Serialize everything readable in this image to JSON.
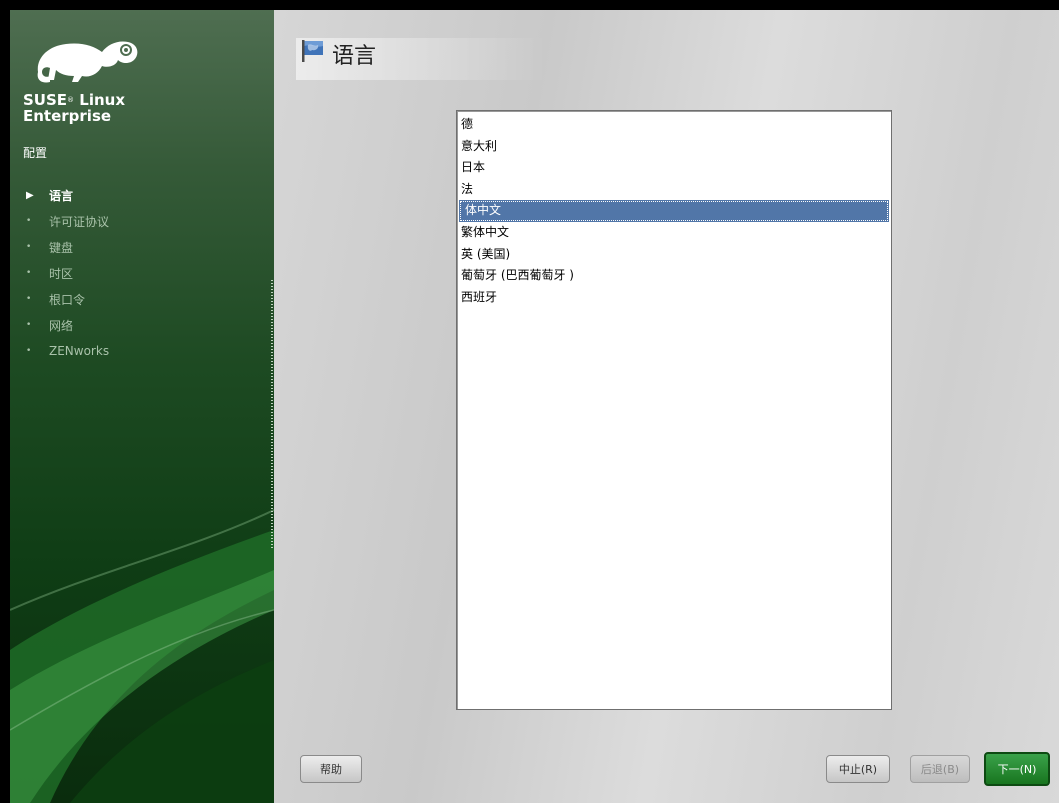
{
  "sidebar": {
    "brand_line1": "SUSE",
    "brand_reg": "®",
    "brand_line1b": " Linux",
    "brand_line2": "Enterprise",
    "section_title": "配置",
    "steps": [
      {
        "label": "语言",
        "active": true
      },
      {
        "label": "许可证协议",
        "active": false
      },
      {
        "label": "键盘",
        "active": false
      },
      {
        "label": "时区",
        "active": false
      },
      {
        "label": "根口令",
        "active": false
      },
      {
        "label": "网络",
        "active": false
      },
      {
        "label": "ZENworks",
        "active": false
      }
    ],
    "active_marker": "▶",
    "inactive_marker": "•"
  },
  "main": {
    "title": "语言",
    "title_icon": "flag-icon",
    "languages": [
      {
        "label": "德"
      },
      {
        "label": "意大利"
      },
      {
        "label": "日本"
      },
      {
        "label": "法"
      },
      {
        "label": "体中文"
      },
      {
        "label": "繁体中文"
      },
      {
        "label": "英 (美国)"
      },
      {
        "label": "葡萄牙 (巴西葡萄牙 )"
      },
      {
        "label": "西班牙"
      }
    ],
    "selected_language": "体中文"
  },
  "buttons": {
    "help": "帮助",
    "abort": "中止(R)",
    "back": "后退(B)",
    "next": "下一(N)"
  },
  "colors": {
    "sidebar_green": "#1d4a22",
    "selection_blue": "#5176a8",
    "next_green": "#2a8a35"
  }
}
